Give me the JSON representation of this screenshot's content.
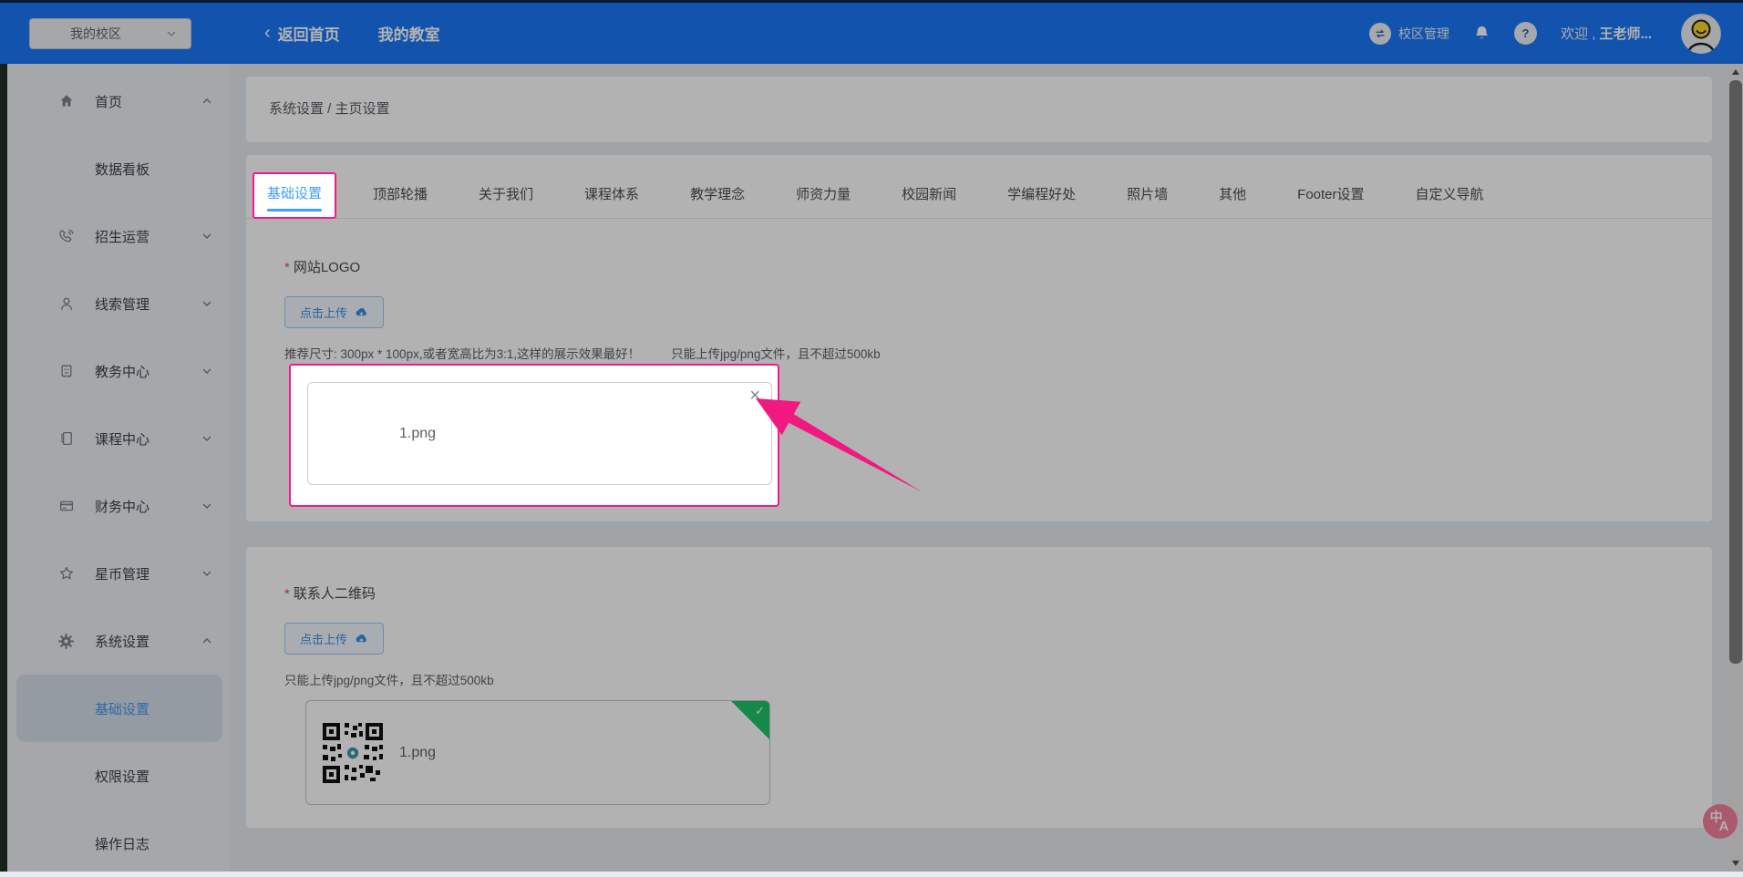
{
  "header": {
    "campus_select": "我的校区",
    "back_home": "返回首页",
    "my_classroom": "我的教室",
    "campus_manage": "校区管理",
    "welcome_prefix": "欢迎 ,",
    "username": "王老师...",
    "translate_zh": "中",
    "translate_a": "A"
  },
  "sidebar": {
    "items": [
      {
        "label": "首页"
      },
      {
        "label": "数据看板"
      },
      {
        "label": "招生运营"
      },
      {
        "label": "线索管理"
      },
      {
        "label": "教务中心"
      },
      {
        "label": "课程中心"
      },
      {
        "label": "财务中心"
      },
      {
        "label": "星币管理"
      },
      {
        "label": "系统设置"
      },
      {
        "label": "基础设置"
      },
      {
        "label": "权限设置"
      },
      {
        "label": "操作日志"
      }
    ]
  },
  "breadcrumb": {
    "path": "系统设置 / 主页设置"
  },
  "tabs": {
    "items": [
      "基础设置",
      "顶部轮播",
      "关于我们",
      "课程体系",
      "教学理念",
      "师资力量",
      "校园新闻",
      "学编程好处",
      "照片墙",
      "其他",
      "Footer设置",
      "自定义导航"
    ],
    "active": "基础设置"
  },
  "logo_section": {
    "required_mark": "*",
    "label": "网站LOGO",
    "upload_button": "点击上传",
    "hint_size": "推荐尺寸: 300px * 100px,或者宽高比为3:1,这样的展示效果最好！",
    "hint_type": "只能上传jpg/png文件，且不超过500kb",
    "filename": "1.png",
    "close_glyph": "×"
  },
  "qr_section": {
    "required_mark": "*",
    "label": "联系人二维码",
    "upload_button": "点击上传",
    "hint_type": "只能上传jpg/png文件，且不超过500kb",
    "filename": "1.png",
    "check_glyph": "✓"
  },
  "colors": {
    "accent": "#409EFF",
    "highlight": "#F1197F",
    "success": "#1EC568",
    "header_blue": "#1A78F8"
  }
}
